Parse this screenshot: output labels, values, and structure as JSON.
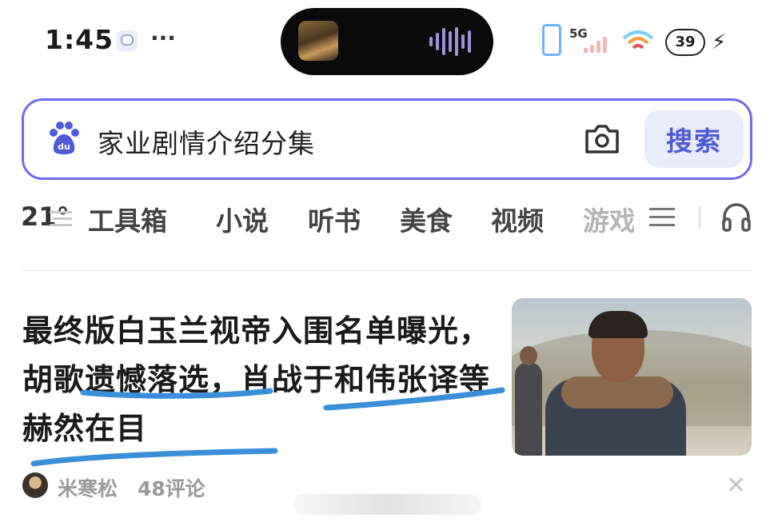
{
  "status_bar": {
    "time": "1:45",
    "dots": "···",
    "network": "5G",
    "battery": "39"
  },
  "search": {
    "query": "家业剧情介绍分集",
    "button_label": "搜索"
  },
  "nav": {
    "weather": "21°",
    "items": [
      "工具箱",
      "小说",
      "听书",
      "美食",
      "视频",
      "游戏"
    ]
  },
  "news": {
    "headline": "最终版白玉兰视帝入围名单曝光，胡歌遗憾落选，肖战于和伟张译等赫然在目",
    "author": "米寒松",
    "comments": "48评论",
    "close": "✕"
  },
  "colors": {
    "accent": "#6d6cf0",
    "search_button_bg": "#e9ecfb",
    "search_button_text": "#4e5ad8",
    "underline": "#3a8fd8"
  }
}
